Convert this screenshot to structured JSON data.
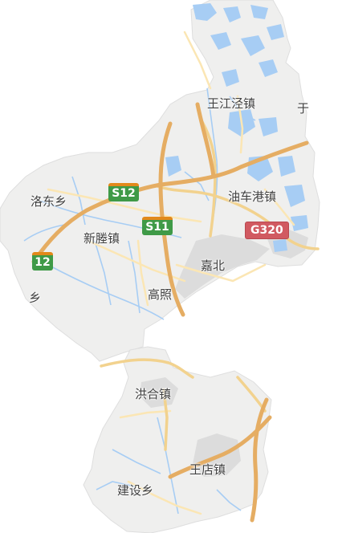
{
  "map": {
    "colors": {
      "land": "#efefee",
      "outside": "#ffffff",
      "water": "#a7cdf4",
      "highway": "#e5ad63",
      "road_major": "#f2d28e",
      "road_minor": "#fbe6b4",
      "urban": "#dcdcdc",
      "label": "#404040",
      "provincial_shield": "#3f9a47",
      "national_shield": "#d15a61"
    },
    "places": [
      {
        "id": "wangjiangjing",
        "name": "王江泾镇"
      },
      {
        "id": "luodong",
        "name": "洛东乡"
      },
      {
        "id": "youchegang",
        "name": "油车港镇"
      },
      {
        "id": "xinsheng",
        "name": "新塍镇"
      },
      {
        "id": "jiabei",
        "name": "嘉北"
      },
      {
        "id": "gaozhao",
        "name": "高照"
      },
      {
        "id": "honghe",
        "name": "洪合镇"
      },
      {
        "id": "wangdian",
        "name": "王店镇"
      },
      {
        "id": "jianshe",
        "name": "建设乡"
      },
      {
        "id": "edge_left",
        "name": "乡"
      },
      {
        "id": "edge_right",
        "name": "于"
      }
    ],
    "shields": [
      {
        "id": "s12-center",
        "label": "S12",
        "icon": "provincial-expressway-shield"
      },
      {
        "id": "s11",
        "label": "S11",
        "icon": "provincial-expressway-shield"
      },
      {
        "id": "s12-left",
        "label": "12",
        "icon": "provincial-expressway-shield"
      },
      {
        "id": "g320",
        "label": "G320",
        "icon": "national-road-shield"
      }
    ]
  }
}
